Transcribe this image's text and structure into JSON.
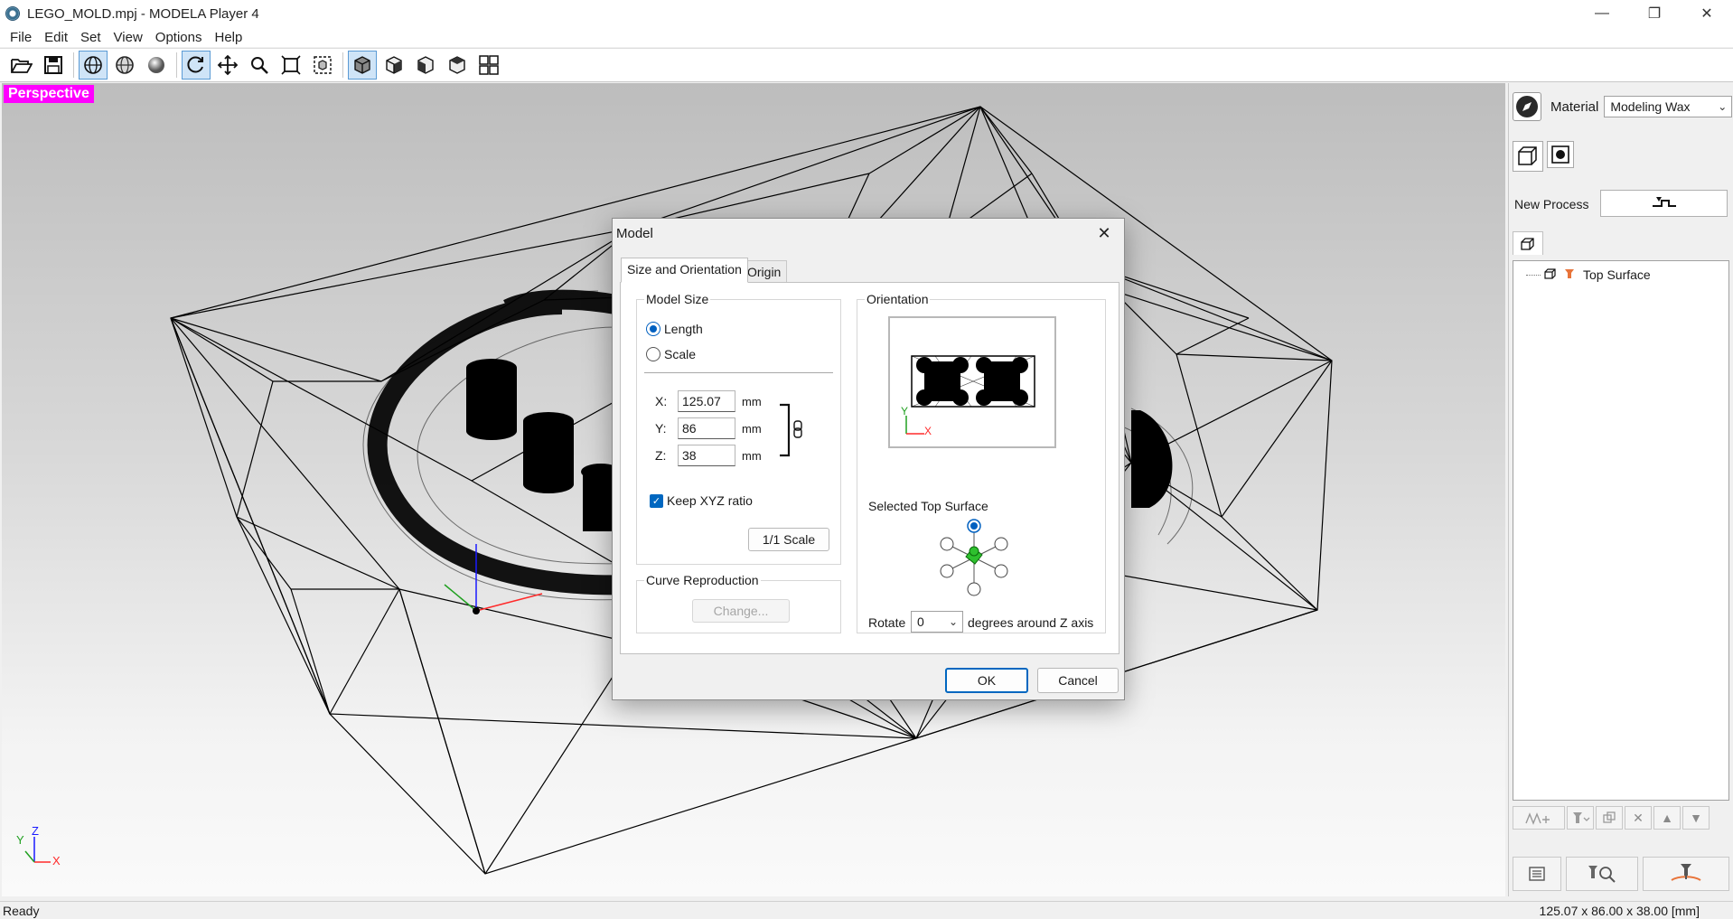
{
  "window": {
    "title": "LEGO_MOLD.mpj - MODELA Player 4",
    "controls": [
      "minimize",
      "restore",
      "close"
    ]
  },
  "menu": [
    "File",
    "Edit",
    "Set",
    "View",
    "Options",
    "Help"
  ],
  "toolbar": {
    "buttons": [
      "open-icon",
      "save-icon",
      "wireframe-icon",
      "shaded-wire-icon",
      "shaded-icon",
      "rotate-icon",
      "pan-icon",
      "zoom-icon",
      "fit-icon",
      "zoom-selection-icon",
      "view-perspective-icon",
      "view-front-icon",
      "view-side-icon",
      "view-top-icon",
      "view-quad-icon"
    ],
    "active": [
      "wireframe-icon",
      "rotate-icon",
      "view-perspective-icon"
    ]
  },
  "viewport": {
    "label": "Perspective",
    "axis_triad": {
      "y": "Y",
      "z": "Z",
      "x": "X"
    }
  },
  "right_panel": {
    "material_label": "Material",
    "material_value": "Modeling Wax",
    "new_process_label": "New Process",
    "tree_items": [
      "Top Surface"
    ]
  },
  "status": {
    "left": "Ready",
    "right": "125.07 x 86.00 x 38.00 [mm]"
  },
  "dialog": {
    "title": "Model",
    "tabs": [
      "Size and Orientation",
      "Origin"
    ],
    "active_tab": "Size and Orientation",
    "model_size": {
      "group_title": "Model Size",
      "options": [
        "Length",
        "Scale"
      ],
      "selected": "Length",
      "x_label": "X:",
      "x_value": "125.07",
      "y_label": "Y:",
      "y_value": "86",
      "z_label": "Z:",
      "z_value": "38",
      "unit": "mm",
      "keep_ratio_label": "Keep XYZ ratio",
      "keep_ratio_checked": true,
      "scale_button": "1/1 Scale"
    },
    "curve": {
      "group_title": "Curve Reproduction",
      "change_button": "Change..."
    },
    "orientation": {
      "group_title": "Orientation",
      "preview_axes": {
        "y": "Y",
        "x": "X"
      },
      "selected_surface_label": "Selected Top Surface",
      "rotate_label": "Rotate",
      "rotate_value": "0",
      "rotate_suffix": "degrees around Z axis"
    },
    "ok": "OK",
    "cancel": "Cancel"
  }
}
